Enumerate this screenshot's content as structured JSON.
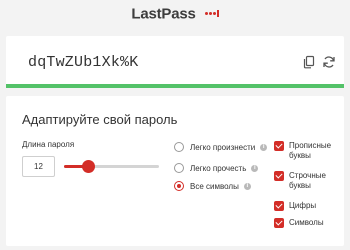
{
  "brand": {
    "name": "LastPass"
  },
  "password": {
    "value": "dqTwZUb1Xk%K",
    "strength_color": "#53c268"
  },
  "icons": {
    "copy": "copy-icon",
    "refresh": "refresh-icon"
  },
  "settings": {
    "title": "Адаптируйте свой пароль",
    "length_label": "Длина пароля",
    "length_value": "12",
    "slider_fraction": 0.25,
    "options": [
      {
        "label": "Легко произнести",
        "checked": false
      },
      {
        "label": "Легко прочесть",
        "checked": false
      },
      {
        "label": "Все символы",
        "checked": true
      }
    ],
    "checks": [
      {
        "label": "Прописные буквы",
        "checked": true
      },
      {
        "label": "Строчные буквы",
        "checked": true
      },
      {
        "label": "Цифры",
        "checked": true
      },
      {
        "label": "Символы",
        "checked": true
      }
    ]
  },
  "colors": {
    "accent": "#d32d27",
    "background": "#f3f3f3"
  }
}
